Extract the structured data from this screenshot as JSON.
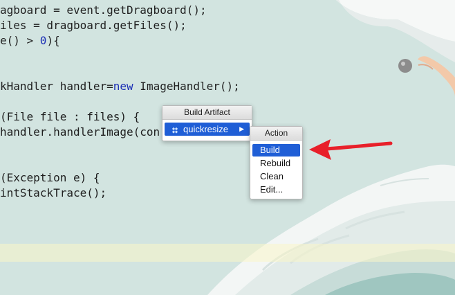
{
  "code_lines": [
    [
      {
        "t": "agboard = event.getDragboard();",
        "c": ""
      }
    ],
    [
      {
        "t": "iles = dragboard.getFiles();",
        "c": ""
      }
    ],
    [
      {
        "t": "e() > ",
        "c": ""
      },
      {
        "t": "0",
        "c": "num"
      },
      {
        "t": "){",
        "c": ""
      }
    ],
    [
      {
        "t": "",
        "c": ""
      }
    ],
    [
      {
        "t": "",
        "c": ""
      }
    ],
    [
      {
        "t": "kHandler handler=",
        "c": ""
      },
      {
        "t": "new",
        "c": "kw"
      },
      {
        "t": " ImageHandler();",
        "c": ""
      }
    ],
    [
      {
        "t": "",
        "c": ""
      }
    ],
    [
      {
        "t": "(File file : files) {",
        "c": ""
      }
    ],
    [
      {
        "t": "handler.handlerImage(con",
        "c": ""
      }
    ],
    [
      {
        "t": "",
        "c": ""
      }
    ],
    [
      {
        "t": "",
        "c": ""
      }
    ],
    [
      {
        "t": "(Exception e) {",
        "c": ""
      }
    ],
    [
      {
        "t": "intStackTrace();",
        "c": ""
      }
    ]
  ],
  "build_artifact_menu": {
    "title": "Build Artifact",
    "artifact_label": "quickresize"
  },
  "action_menu": {
    "title": "Action",
    "items": [
      "Build",
      "Rebuild",
      "Clean",
      "Edit..."
    ],
    "selected_index": 0
  },
  "colors": {
    "selection": "#1f5ed6",
    "arrow": "#e8202a",
    "keyword": "#1c2fb5"
  }
}
